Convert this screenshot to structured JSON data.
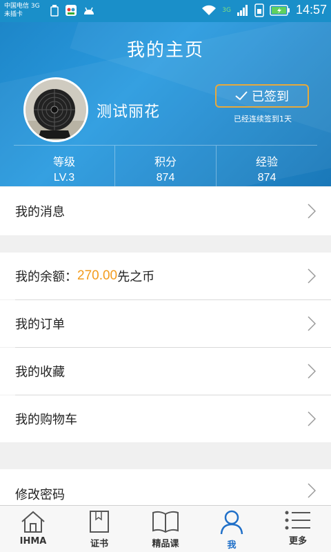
{
  "status_bar": {
    "carrier_line1": "中国电信 3G",
    "carrier_line2": "未插卡",
    "time": "14:57",
    "network": "3G"
  },
  "header": {
    "title": "我的主页",
    "username": "测试丽花",
    "checkin_label": "已签到",
    "checkin_note": "已经连续签到1天",
    "stats": [
      {
        "label": "等级",
        "value": "LV.3"
      },
      {
        "label": "积分",
        "value": "874"
      },
      {
        "label": "经验",
        "value": "874"
      }
    ]
  },
  "menu": {
    "messages": "我的消息",
    "balance_label": "我的余额：",
    "balance_amount": "270.00",
    "balance_unit": "先之币",
    "orders": "我的订单",
    "favorites": "我的收藏",
    "cart": "我的购物车",
    "change_password": "修改密码"
  },
  "tabbar": {
    "tabs": [
      {
        "label": "IHMA",
        "icon": "home-icon"
      },
      {
        "label": "证书",
        "icon": "certificate-icon"
      },
      {
        "label": "精品课",
        "icon": "book-icon"
      },
      {
        "label": "我",
        "icon": "person-icon"
      },
      {
        "label": "更多",
        "icon": "menu-icon"
      }
    ],
    "active_index": 3
  },
  "colors": {
    "header_blue": "#1d86c8",
    "accent_orange": "#f39b1c",
    "active_tab": "#1f6fc8"
  }
}
